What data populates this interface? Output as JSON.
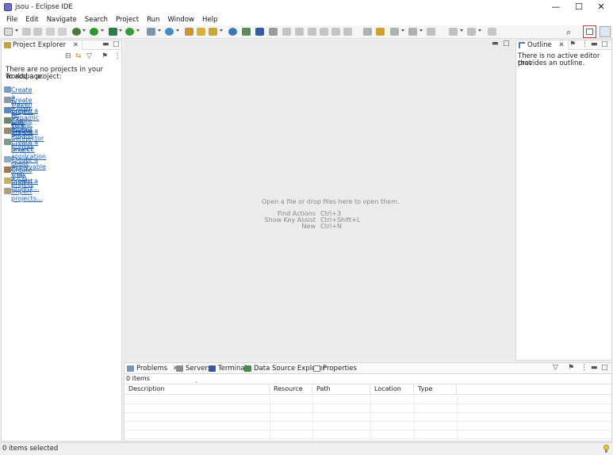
{
  "window": {
    "title": "jsou - Eclipse IDE",
    "minimize": "—",
    "maximize": "☐",
    "close": "✕"
  },
  "menu": [
    "File",
    "Edit",
    "Navigate",
    "Search",
    "Project",
    "Run",
    "Window",
    "Help"
  ],
  "project_explorer": {
    "tab_label": "Project Explorer",
    "empty_message_line1": "There are no projects in your workspace.",
    "empty_message_line2": "To add a project:",
    "links": [
      "Create a Maven project",
      "Create a Java EE EAR project",
      "Create a Dynamic Web project",
      "Create an EJB project",
      "Create a Connector project",
      "Create a Java EE application client",
      "Create a deployable web project.",
      "Create a JPA project",
      "Create a project...",
      "Import projects..."
    ],
    "link_continuation": "project"
  },
  "editor": {
    "drop_hint": "Open a file or drop files here to open them.",
    "shortcuts": [
      {
        "label": "Find Actions",
        "keys": "Ctrl+3"
      },
      {
        "label": "Show Key Assist",
        "keys": "Ctrl+Shift+L"
      },
      {
        "label": "New",
        "keys": "Ctrl+N"
      }
    ]
  },
  "outline": {
    "tab_label": "Outline",
    "message_line1": "There is no active editor that",
    "message_line2": "provides an outline."
  },
  "bottom_panel": {
    "tabs": [
      "Problems",
      "Servers",
      "Terminal",
      "Data Source Explorer",
      "Properties"
    ],
    "item_count": "0 items",
    "columns": [
      "Description",
      "Resource",
      "Path",
      "Location",
      "Type"
    ]
  },
  "status_bar": {
    "text": "0 items selected"
  },
  "colors": {
    "link": "#1a5fb4",
    "highlight": "#e03030"
  }
}
